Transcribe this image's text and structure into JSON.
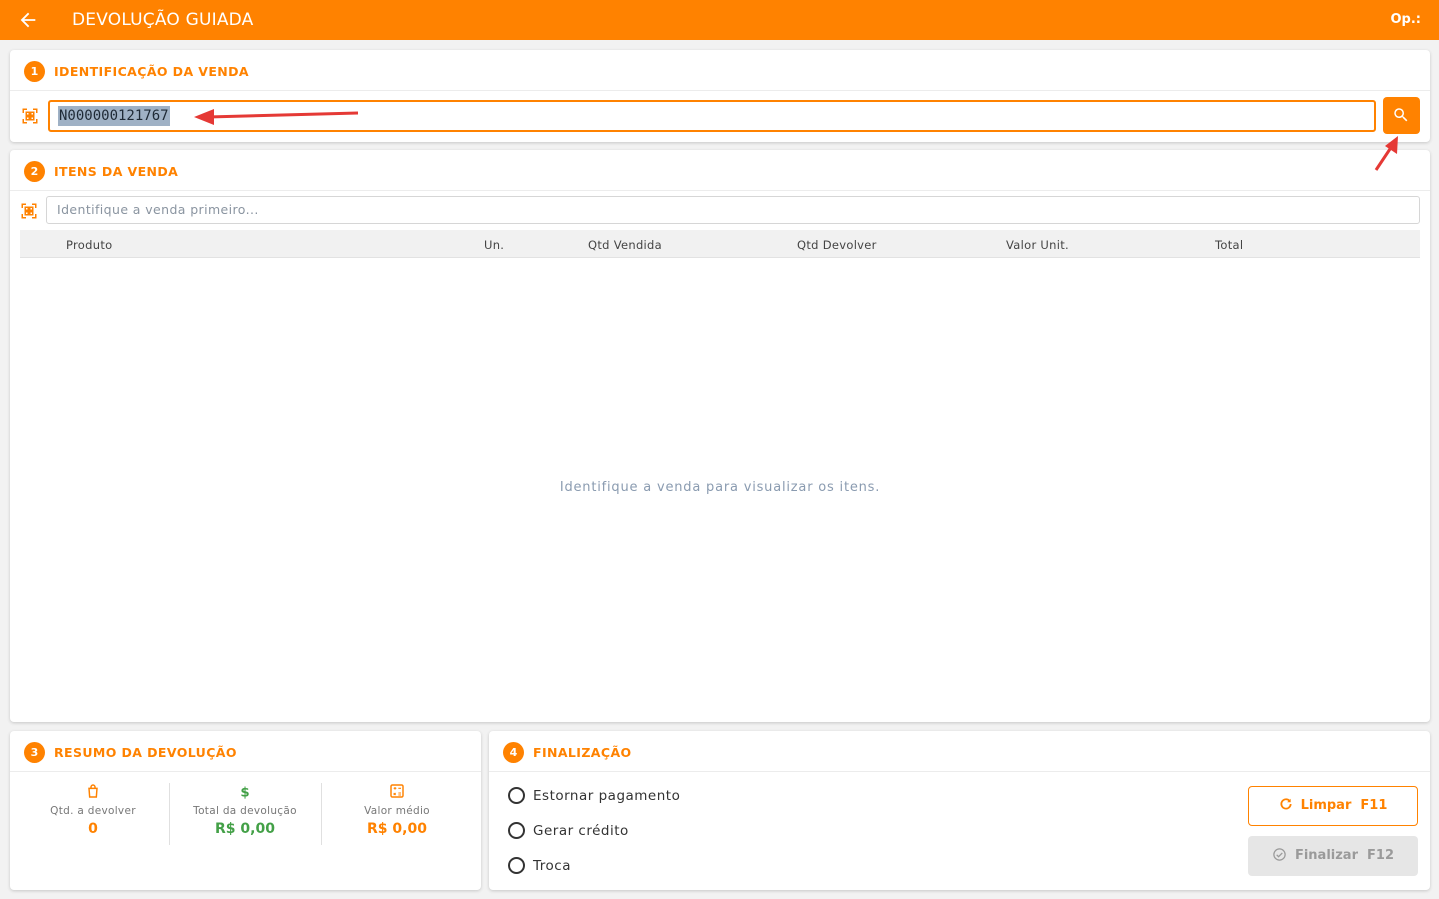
{
  "header": {
    "title": "DEVOLUÇÃO GUIADA",
    "operator_label": "Op.:"
  },
  "section1": {
    "number": "1",
    "title": "IDENTIFICAÇÃO DA VENDA",
    "input_value": "N000000121767"
  },
  "section2": {
    "number": "2",
    "title": "ITENS DA VENDA",
    "input_placeholder": "Identifique a venda primeiro...",
    "columns": [
      "Produto",
      "Un.",
      "Qtd Vendida",
      "Qtd Devolver",
      "Valor Unit.",
      "Total"
    ],
    "empty_message": "Identifique a venda para visualizar os itens."
  },
  "section3": {
    "number": "3",
    "title": "RESUMO DA DEVOLUÇÃO",
    "metrics": [
      {
        "label": "Qtd. a devolver",
        "value": "0",
        "icon": "shopping-bag-icon",
        "color": "#ff8200"
      },
      {
        "label": "Total da devolução",
        "value": "R$ 0,00",
        "icon": "dollar-icon",
        "color": "#43a047"
      },
      {
        "label": "Valor médio",
        "value": "R$ 0,00",
        "icon": "calculator-icon",
        "color": "#ff8200"
      }
    ]
  },
  "section4": {
    "number": "4",
    "title": "FINALIZAÇÃO",
    "options": [
      "Estornar pagamento",
      "Gerar crédito",
      "Troca"
    ],
    "clear_label": "Limpar",
    "clear_key": "F11",
    "finish_label": "Finalizar",
    "finish_key": "F12"
  },
  "colors": {
    "accent": "#ff8200",
    "positive": "#43a047",
    "annotation": "#e53935"
  }
}
